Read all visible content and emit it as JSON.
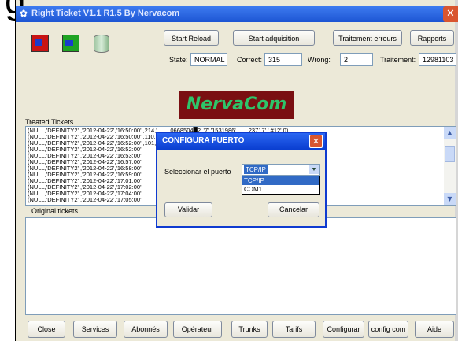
{
  "big_text": "g",
  "window": {
    "title": "Right Ticket V1.1 R1.5 By Nervacom",
    "close_glyph": "✕",
    "title_icon": "✿"
  },
  "toolbar": {
    "start_reload": "Start Reload",
    "start_adquisition": "Start adquisition",
    "traitement_erreurs": "Traitement erreurs",
    "rapports": "Rapports"
  },
  "status": {
    "state_label": "State:",
    "state_value": "NORMAL",
    "correct_label": "Correct:",
    "correct_value": "315",
    "wrong_label": "Wrong:",
    "wrong_value": "2",
    "traitement_label": "Traitement:",
    "traitement_value": "12981103"
  },
  "logo_text": "NervaCom",
  "treated": {
    "label": "Treated Tickets",
    "lines": [
      "(NULL,'DEFINITY2' ,'2012-04-22','16:50:00' ,214,'        0668504█2','7','1531986','      23717',' #12',0)",
      "(NULL,'DEFINITY2' ,'2012-04-22','16:50:00' ,110,'           21075','9','    '','    92███2037',' ',0)",
      "(NULL,'DEFINITY2' ,'2012-04-22','16:52:00' ,101,'        06685███2','7','1531986','      23717',' #12',0)",
      "(NULL,'DEFINITY2' ,'2012-04-22','16:52:00'",
      "(NULL,'DEFINITY2' ,'2012-04-22','16:53:00'",
      "(NULL,'DEFINITY2' ,'2012-04-22','16:57:00'",
      "(NULL,'DEFINITY2' ,'2012-04-22','16:58:00'",
      "(NULL,'DEFINITY2' ,'2012-04-22','16:59:00'",
      "(NULL,'DEFINITY2' ,'2012-04-22','17:01:00'",
      "(NULL,'DEFINITY2' ,'2012-04-22','17:02:00'",
      "(NULL,'DEFINITY2' ,'2012-04-22','17:04:00'",
      "(NULL,'DEFINITY2' ,'2012-04-22','17:05:00'"
    ],
    "scroll_up": "▲",
    "scroll_down": "▼"
  },
  "original": {
    "label": "Original tickets"
  },
  "bottom_buttons": [
    "Close",
    "Services",
    "Abonnés",
    "Opérateur",
    "Trunks",
    "Tarifs",
    "Configurar",
    "config com",
    "Aide"
  ],
  "dialog": {
    "title": "CONFIGURA PUERTO",
    "close_glyph": "✕",
    "port_label": "Seleccionar el puerto",
    "selected": "TCP/IP",
    "arrow": "▼",
    "options": [
      "TCP/IP",
      "COM1"
    ],
    "validar": "Validar",
    "cancelar": "Cancelar"
  }
}
